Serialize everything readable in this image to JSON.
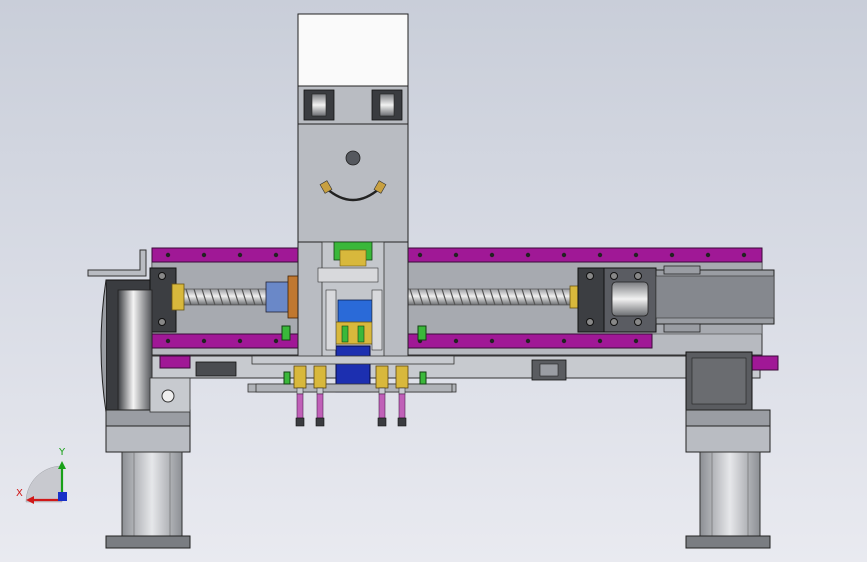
{
  "view": {
    "background_top": "#c9ced9",
    "background_bottom": "#e9eaf0"
  },
  "triad": {
    "x_label": "X",
    "y_label": "Y",
    "x_color": "#d01818",
    "y_color": "#18a018",
    "z_color": "#1830c8"
  },
  "colors": {
    "rail": "#a01896",
    "body_gray": "#b9bcc2",
    "dark_gray": "#55585e",
    "motor_white": "#fafafa",
    "brass": "#c8a040",
    "blue_block": "#1c2fb0",
    "green_part": "#3ab83a",
    "nozzle_pink": "#c060b8",
    "orange_nut": "#c07830"
  },
  "components": [
    "z-axis-motor",
    "z-axis-carriage",
    "upper-purple-rail",
    "lower-purple-rail",
    "ball-screw",
    "x-axis-motor",
    "left-pulley-housing",
    "left-support-leg",
    "right-support-leg",
    "suction-nozzles"
  ]
}
